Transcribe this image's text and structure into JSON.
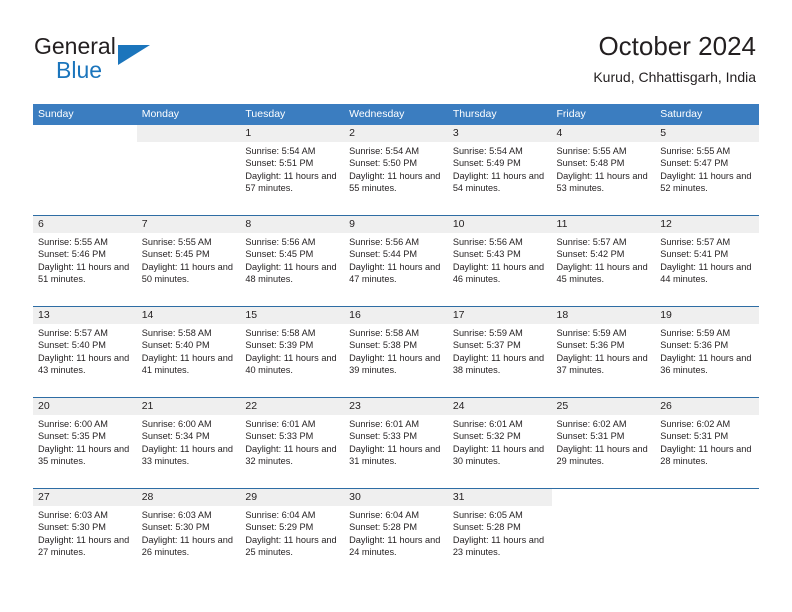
{
  "brand": {
    "name_primary": "General",
    "name_secondary": "Blue",
    "logo_icon": "triangle-icon"
  },
  "header": {
    "title": "October 2024",
    "subtitle": "Kurud, Chhattisgarh, India"
  },
  "calendar": {
    "accent_color": "#3b7dc0",
    "separator_color": "#2e6da4",
    "day_band_color": "#efefef",
    "weekday_headers": [
      "Sunday",
      "Monday",
      "Tuesday",
      "Wednesday",
      "Thursday",
      "Friday",
      "Saturday"
    ],
    "weeks": [
      [
        {
          "day": "",
          "sunrise": "",
          "sunset": "",
          "daylight": "",
          "blank": true
        },
        {
          "day": "",
          "sunrise": "",
          "sunset": "",
          "daylight": "",
          "blank": false
        },
        {
          "day": "1",
          "sunrise": "Sunrise: 5:54 AM",
          "sunset": "Sunset: 5:51 PM",
          "daylight": "Daylight: 11 hours and 57 minutes."
        },
        {
          "day": "2",
          "sunrise": "Sunrise: 5:54 AM",
          "sunset": "Sunset: 5:50 PM",
          "daylight": "Daylight: 11 hours and 55 minutes."
        },
        {
          "day": "3",
          "sunrise": "Sunrise: 5:54 AM",
          "sunset": "Sunset: 5:49 PM",
          "daylight": "Daylight: 11 hours and 54 minutes."
        },
        {
          "day": "4",
          "sunrise": "Sunrise: 5:55 AM",
          "sunset": "Sunset: 5:48 PM",
          "daylight": "Daylight: 11 hours and 53 minutes."
        },
        {
          "day": "5",
          "sunrise": "Sunrise: 5:55 AM",
          "sunset": "Sunset: 5:47 PM",
          "daylight": "Daylight: 11 hours and 52 minutes."
        }
      ],
      [
        {
          "day": "6",
          "sunrise": "Sunrise: 5:55 AM",
          "sunset": "Sunset: 5:46 PM",
          "daylight": "Daylight: 11 hours and 51 minutes."
        },
        {
          "day": "7",
          "sunrise": "Sunrise: 5:55 AM",
          "sunset": "Sunset: 5:45 PM",
          "daylight": "Daylight: 11 hours and 50 minutes."
        },
        {
          "day": "8",
          "sunrise": "Sunrise: 5:56 AM",
          "sunset": "Sunset: 5:45 PM",
          "daylight": "Daylight: 11 hours and 48 minutes."
        },
        {
          "day": "9",
          "sunrise": "Sunrise: 5:56 AM",
          "sunset": "Sunset: 5:44 PM",
          "daylight": "Daylight: 11 hours and 47 minutes."
        },
        {
          "day": "10",
          "sunrise": "Sunrise: 5:56 AM",
          "sunset": "Sunset: 5:43 PM",
          "daylight": "Daylight: 11 hours and 46 minutes."
        },
        {
          "day": "11",
          "sunrise": "Sunrise: 5:57 AM",
          "sunset": "Sunset: 5:42 PM",
          "daylight": "Daylight: 11 hours and 45 minutes."
        },
        {
          "day": "12",
          "sunrise": "Sunrise: 5:57 AM",
          "sunset": "Sunset: 5:41 PM",
          "daylight": "Daylight: 11 hours and 44 minutes."
        }
      ],
      [
        {
          "day": "13",
          "sunrise": "Sunrise: 5:57 AM",
          "sunset": "Sunset: 5:40 PM",
          "daylight": "Daylight: 11 hours and 43 minutes."
        },
        {
          "day": "14",
          "sunrise": "Sunrise: 5:58 AM",
          "sunset": "Sunset: 5:40 PM",
          "daylight": "Daylight: 11 hours and 41 minutes."
        },
        {
          "day": "15",
          "sunrise": "Sunrise: 5:58 AM",
          "sunset": "Sunset: 5:39 PM",
          "daylight": "Daylight: 11 hours and 40 minutes."
        },
        {
          "day": "16",
          "sunrise": "Sunrise: 5:58 AM",
          "sunset": "Sunset: 5:38 PM",
          "daylight": "Daylight: 11 hours and 39 minutes."
        },
        {
          "day": "17",
          "sunrise": "Sunrise: 5:59 AM",
          "sunset": "Sunset: 5:37 PM",
          "daylight": "Daylight: 11 hours and 38 minutes."
        },
        {
          "day": "18",
          "sunrise": "Sunrise: 5:59 AM",
          "sunset": "Sunset: 5:36 PM",
          "daylight": "Daylight: 11 hours and 37 minutes."
        },
        {
          "day": "19",
          "sunrise": "Sunrise: 5:59 AM",
          "sunset": "Sunset: 5:36 PM",
          "daylight": "Daylight: 11 hours and 36 minutes."
        }
      ],
      [
        {
          "day": "20",
          "sunrise": "Sunrise: 6:00 AM",
          "sunset": "Sunset: 5:35 PM",
          "daylight": "Daylight: 11 hours and 35 minutes."
        },
        {
          "day": "21",
          "sunrise": "Sunrise: 6:00 AM",
          "sunset": "Sunset: 5:34 PM",
          "daylight": "Daylight: 11 hours and 33 minutes."
        },
        {
          "day": "22",
          "sunrise": "Sunrise: 6:01 AM",
          "sunset": "Sunset: 5:33 PM",
          "daylight": "Daylight: 11 hours and 32 minutes."
        },
        {
          "day": "23",
          "sunrise": "Sunrise: 6:01 AM",
          "sunset": "Sunset: 5:33 PM",
          "daylight": "Daylight: 11 hours and 31 minutes."
        },
        {
          "day": "24",
          "sunrise": "Sunrise: 6:01 AM",
          "sunset": "Sunset: 5:32 PM",
          "daylight": "Daylight: 11 hours and 30 minutes."
        },
        {
          "day": "25",
          "sunrise": "Sunrise: 6:02 AM",
          "sunset": "Sunset: 5:31 PM",
          "daylight": "Daylight: 11 hours and 29 minutes."
        },
        {
          "day": "26",
          "sunrise": "Sunrise: 6:02 AM",
          "sunset": "Sunset: 5:31 PM",
          "daylight": "Daylight: 11 hours and 28 minutes."
        }
      ],
      [
        {
          "day": "27",
          "sunrise": "Sunrise: 6:03 AM",
          "sunset": "Sunset: 5:30 PM",
          "daylight": "Daylight: 11 hours and 27 minutes."
        },
        {
          "day": "28",
          "sunrise": "Sunrise: 6:03 AM",
          "sunset": "Sunset: 5:30 PM",
          "daylight": "Daylight: 11 hours and 26 minutes."
        },
        {
          "day": "29",
          "sunrise": "Sunrise: 6:04 AM",
          "sunset": "Sunset: 5:29 PM",
          "daylight": "Daylight: 11 hours and 25 minutes."
        },
        {
          "day": "30",
          "sunrise": "Sunrise: 6:04 AM",
          "sunset": "Sunset: 5:28 PM",
          "daylight": "Daylight: 11 hours and 24 minutes."
        },
        {
          "day": "31",
          "sunrise": "Sunrise: 6:05 AM",
          "sunset": "Sunset: 5:28 PM",
          "daylight": "Daylight: 11 hours and 23 minutes."
        },
        {
          "day": "",
          "sunrise": "",
          "sunset": "",
          "daylight": "",
          "blank": true
        },
        {
          "day": "",
          "sunrise": "",
          "sunset": "",
          "daylight": "",
          "blank": true
        }
      ]
    ]
  }
}
